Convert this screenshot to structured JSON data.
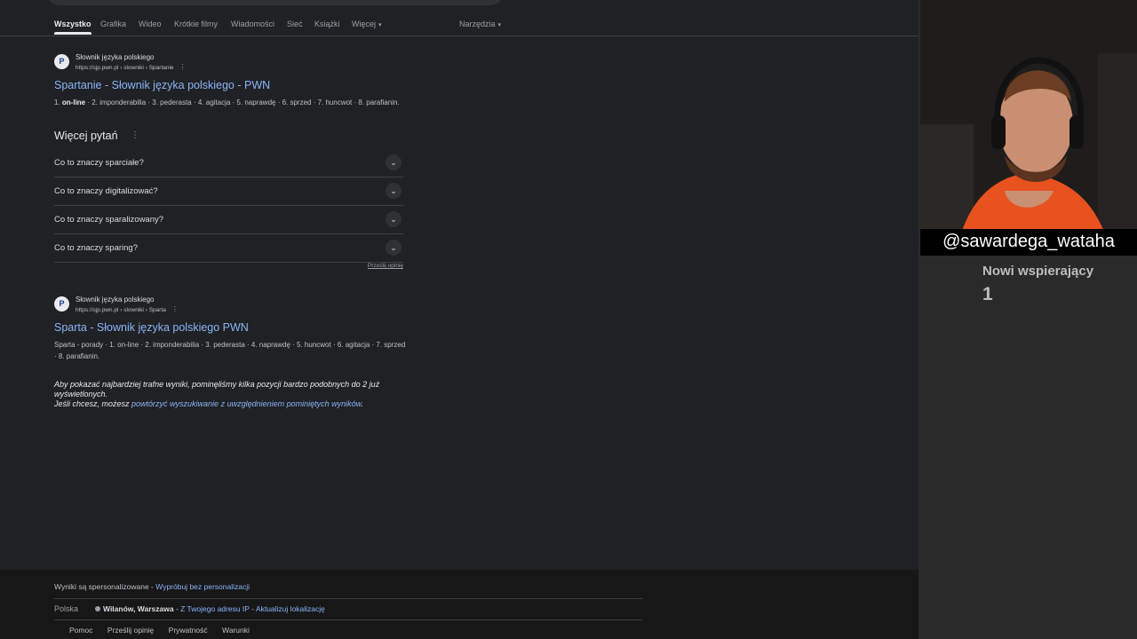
{
  "tabs": [
    {
      "label": "Wszystko",
      "active": true
    },
    {
      "label": "Grafika"
    },
    {
      "label": "Wideo"
    },
    {
      "label": "Krótkie filmy"
    },
    {
      "label": "Wiadomości"
    },
    {
      "label": "Sieć"
    },
    {
      "label": "Książki"
    },
    {
      "label": "Więcej"
    },
    {
      "label": "Narzędzia"
    }
  ],
  "results": [
    {
      "site_name": "Słownik języka polskiego",
      "url": "https://sjp.pwn.pl › slowniki › Spartanie",
      "title": "Spartanie - Słownik języka polskiego - PWN",
      "snippet_prefix": "1. ",
      "snippet_bold": "on-line",
      "snippet_rest": " · 2. imponderabilia · 3. pederasta · 4. agitacja · 5. naprawdę · 6. sprzed · 7. huncwot · 8. parafianin."
    },
    {
      "site_name": "Słownik języka polskiego",
      "url": "https://sjp.pwn.pl › slowniki › Sparta",
      "title": "Sparta - Słownik języka polskiego PWN",
      "snippet": "Sparta - porady · 1. on-line · 2. imponderabilia · 3. pederasta · 4. naprawdę · 5. huncwot · 6. agitacja · 7. sprzed · 8. parafianin."
    }
  ],
  "paa": {
    "title": "Więcej pytań",
    "questions": [
      "Co to znaczy sparciałe?",
      "Co to znaczy digitalizować?",
      "Co to znaczy sparalizowany?",
      "Co to znaczy sparing?"
    ],
    "feedback": "Prześlij opinię"
  },
  "omitted": {
    "line1": "Aby pokazać najbardziej trafne wyniki, pominęliśmy kilka pozycji bardzo podobnych do 2 już wyświetlonych.",
    "line2_prefix": "Jeśli chcesz, możesz ",
    "line2_link": "powtórzyć wyszukiwanie z uwzględnieniem pominiętych wyników",
    "line2_suffix": "."
  },
  "footer": {
    "personalized": "Wyniki są spersonalizowane - ",
    "personalized_link": "Wypróbuj bez personalizacji",
    "country": "Polska",
    "location": "Wilanów, Warszawa",
    "location_sep": " - ",
    "ip_link": "Z Twojego adresu IP",
    "update_link": "Aktualizuj lokalizację",
    "links": [
      "Pomoc",
      "Prześlij opinię",
      "Prywatność",
      "Warunki"
    ]
  },
  "stream": {
    "handle": "@sawardega_wataha",
    "supporters_label": "Nowi wspierający",
    "supporters_count": "1"
  },
  "colors": {
    "background": "#202124",
    "link": "#8ab4f8",
    "text": "#bdc1c6"
  },
  "icons": {
    "favicon": "pwn-logo-icon",
    "question_toggle": "chevron-down-icon",
    "more": "kebab-menu-icon"
  }
}
